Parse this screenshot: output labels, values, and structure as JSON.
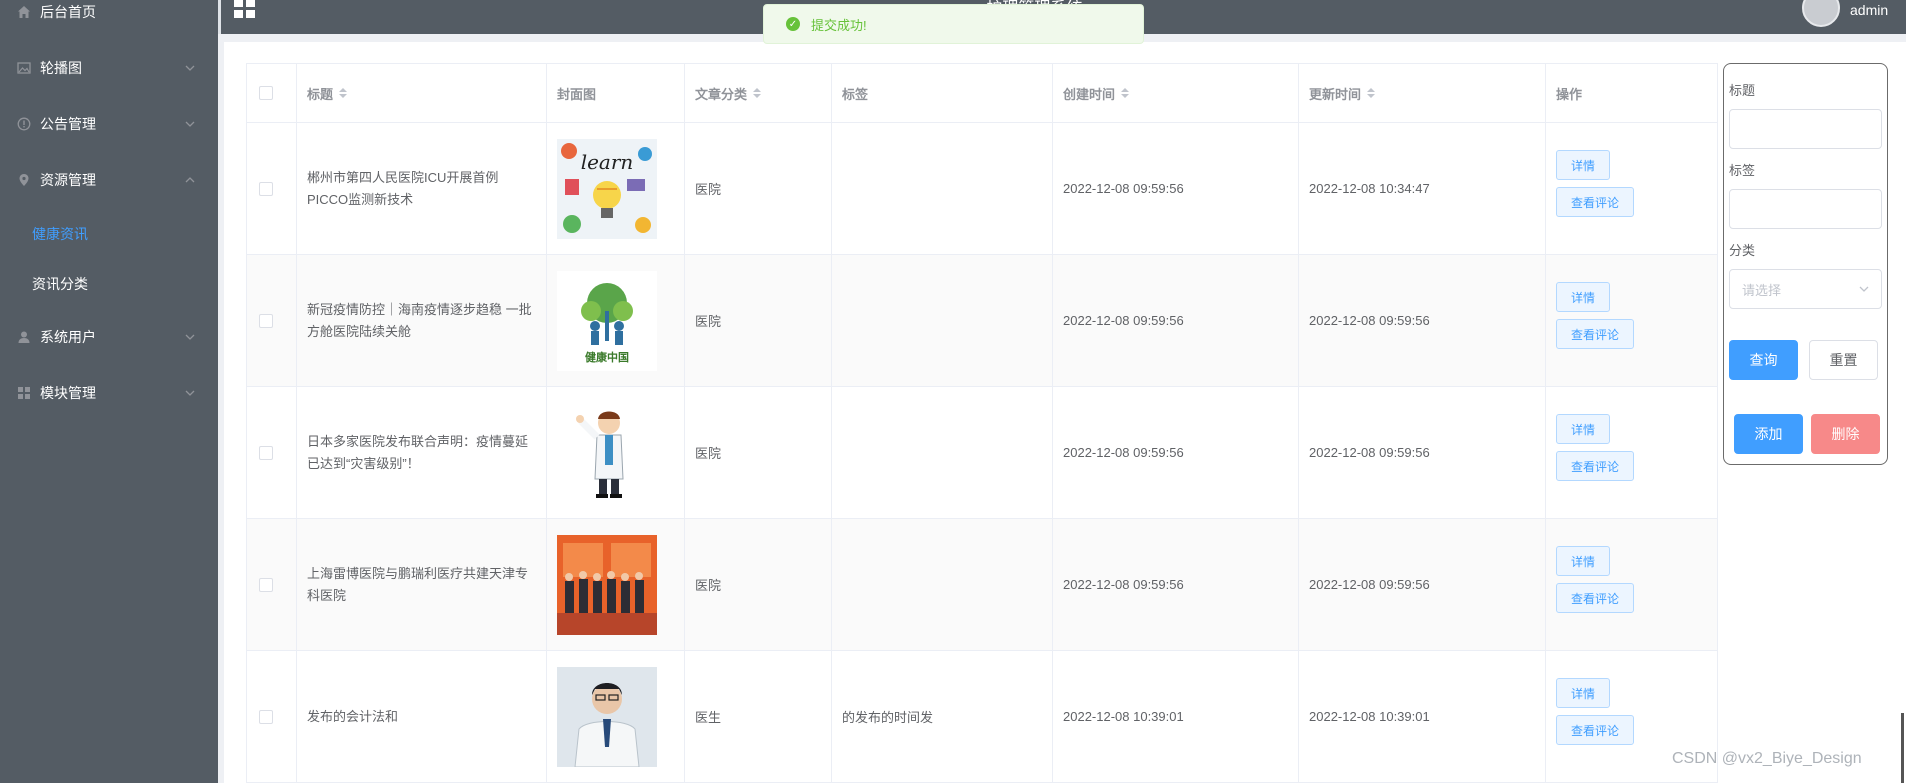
{
  "app": {
    "title": "...护理管理系统",
    "user": "admin"
  },
  "sidebar": {
    "items": [
      {
        "label": "后台首页",
        "icon": "home-icon"
      },
      {
        "label": "轮播图",
        "icon": "image-icon"
      },
      {
        "label": "公告管理",
        "icon": "info-icon"
      },
      {
        "label": "资源管理",
        "icon": "location-icon",
        "expanded": true,
        "children": [
          {
            "label": "健康资讯",
            "active": true
          },
          {
            "label": "资讯分类"
          }
        ]
      },
      {
        "label": "系统用户",
        "icon": "user-icon"
      },
      {
        "label": "模块管理",
        "icon": "menu-icon"
      }
    ]
  },
  "toast": {
    "message": "提交成功!",
    "type": "success"
  },
  "table": {
    "headers": {
      "title": "标题",
      "cover": "封面图",
      "category": "文章分类",
      "tags": "标签",
      "created": "创建时间",
      "updated": "更新时间",
      "actions": "操作"
    },
    "rows": [
      {
        "title": "郴州市第四人民医院ICU开展首例PICCO监测新技术",
        "category": "医院",
        "tags": "",
        "created": "2022-12-08 09:59:56",
        "updated": "2022-12-08 10:34:47",
        "cover": "learn"
      },
      {
        "title": "新冠疫情防控｜海南疫情逐步趋稳 一批方舱医院陆续关舱",
        "category": "医院",
        "tags": "",
        "created": "2022-12-08 09:59:56",
        "updated": "2022-12-08 09:59:56",
        "cover": "health-china"
      },
      {
        "title": "日本多家医院发布联合声明：疫情蔓延已达到“灾害级别”！",
        "category": "医院",
        "tags": "",
        "created": "2022-12-08 09:59:56",
        "updated": "2022-12-08 09:59:56",
        "cover": "doctor-cartoon"
      },
      {
        "title": "上海雷博医院与鹏瑞利医疗共建天津专科医院",
        "category": "医院",
        "tags": "",
        "created": "2022-12-08 09:59:56",
        "updated": "2022-12-08 09:59:56",
        "cover": "group-photo"
      },
      {
        "title": "发布的会计法和",
        "category": "医生",
        "tags": "的发布的时间发",
        "created": "2022-12-08 10:39:01",
        "updated": "2022-12-08 10:39:01",
        "cover": "doctor-photo"
      }
    ],
    "row_actions": {
      "detail": "详情",
      "comments": "查看评论"
    }
  },
  "search": {
    "title_label": "标题",
    "tag_label": "标签",
    "category_label": "分类",
    "category_placeholder": "请选择",
    "query_button": "查询",
    "reset_button": "重置",
    "add_button": "添加",
    "delete_button": "删除"
  },
  "watermark": "CSDN @vx2_Biye_Design",
  "colors": {
    "sidebar_bg": "#545c64",
    "primary": "#409eff",
    "danger": "#f78989",
    "success": "#67c23a"
  }
}
